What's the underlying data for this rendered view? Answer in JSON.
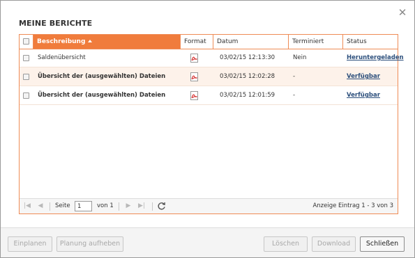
{
  "dialog": {
    "title": "MEINE BERICHTE",
    "close_icon": "close-icon"
  },
  "table": {
    "columns": [
      "Beschreibung",
      "Format",
      "Datum",
      "Terminiert",
      "Status"
    ],
    "sorted_column": "Beschreibung",
    "sort_direction": "ascending",
    "rows": [
      {
        "description": "Saldenübersicht",
        "format_icon": "pdf-icon",
        "date": "03/02/15 12:13:30",
        "scheduled": "Nein",
        "status": "Heruntergeladen",
        "bold": false
      },
      {
        "description": "Übersicht der (ausgewählten) Dateien",
        "format_icon": "pdf-icon",
        "date": "03/02/15 12:02:28",
        "scheduled": "-",
        "status": "Verfügbar",
        "bold": true
      },
      {
        "description": "Übersicht der (ausgewählten) Dateien",
        "format_icon": "pdf-icon",
        "date": "03/02/15 12:01:59",
        "scheduled": "-",
        "status": "Verfügbar",
        "bold": true
      }
    ]
  },
  "pager": {
    "page_label": "Seite",
    "page_value": "1",
    "of_label": "von 1",
    "summary": "Anzeige Eintrag 1 - 3 von 3"
  },
  "footer": {
    "schedule": "Einplanen",
    "unschedule": "Planung aufheben",
    "delete": "Löschen",
    "download": "Download",
    "close": "Schließen"
  },
  "colors": {
    "accent": "#f07c3c",
    "border": "#ef8b55",
    "link": "#2c4f7c"
  }
}
